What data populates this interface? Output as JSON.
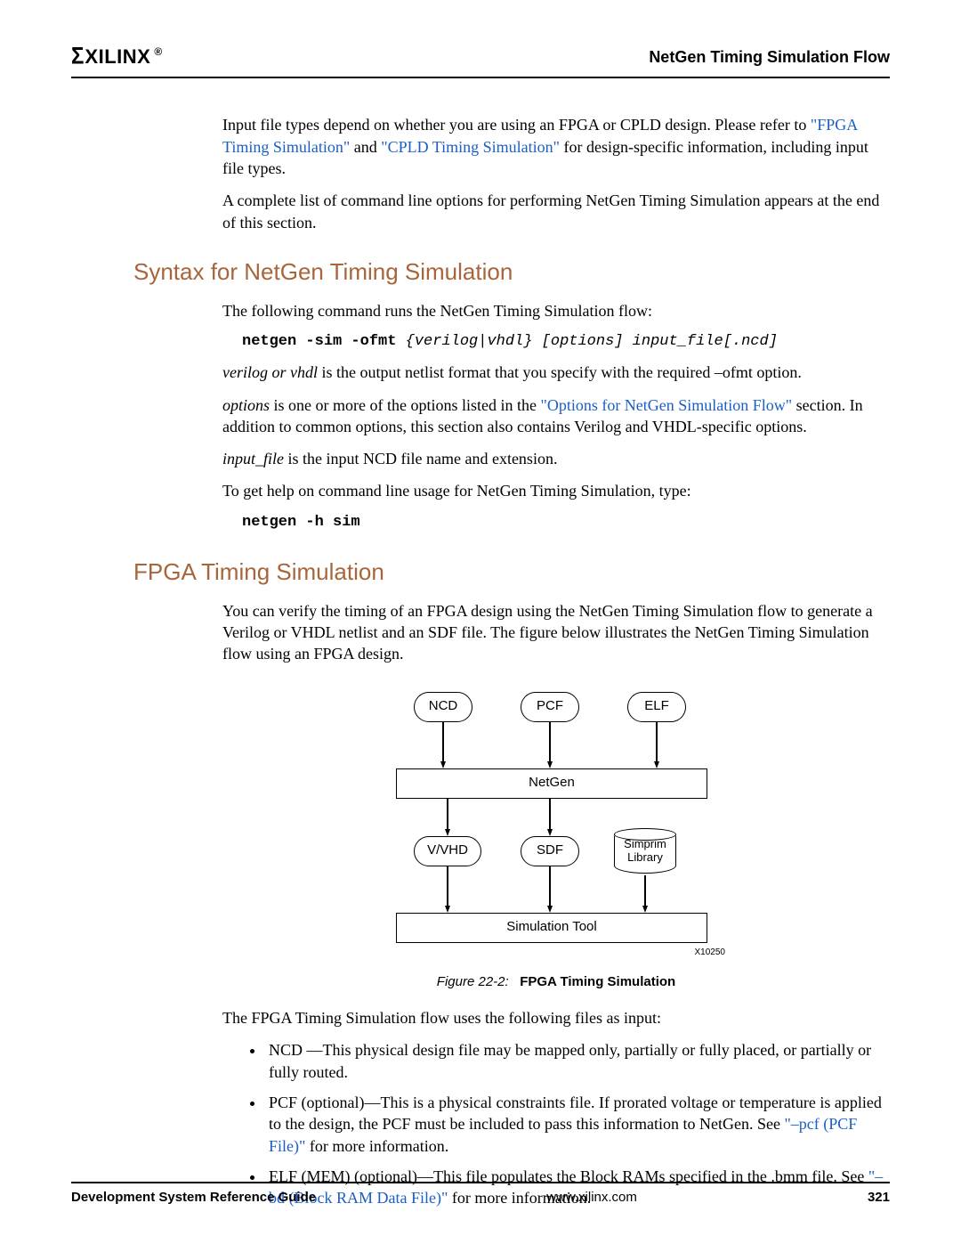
{
  "logo": {
    "sigmas": "Σ",
    "name": "XILINX",
    "reg": "®"
  },
  "header_title": "NetGen Timing Simulation Flow",
  "intro": {
    "p1a": "Input file types depend on whether you are using an FPGA or CPLD design. Please refer to ",
    "link1": "\"FPGA Timing Simulation\"",
    "p1mid": " and ",
    "link2": "\"CPLD Timing Simulation\"",
    "p1b": " for design-specific information, including input file types.",
    "p2": "A complete list of command line options for performing NetGen Timing Simulation appears at the end of this section."
  },
  "h1": "Syntax for NetGen Timing Simulation",
  "syntax": {
    "p1": "The following command runs the NetGen Timing Simulation flow:",
    "code_bold": "netgen -sim -ofmt ",
    "code_ital": "{verilog|vhdl} [options] input_file[.ncd]",
    "p2a": "verilog or vhdl",
    "p2b": " is the output netlist format that you specify with the required –ofmt option.",
    "p3a": "options",
    "p3b": " is one or more of the options listed in the ",
    "link3": "\"Options for NetGen Simulation Flow\"",
    "p3c": " section. In addition to common options, this section also contains Verilog and VHDL-specific options.",
    "p4a": "input_file",
    "p4b": " is the input NCD file name and extension.",
    "p5": "To get help on command line usage for NetGen Timing Simulation, type:",
    "code2": "netgen -h sim"
  },
  "h2": "FPGA Timing Simulation",
  "fpga": {
    "p1": "You can verify the timing of an FPGA design using the NetGen Timing Simulation flow to generate a Verilog or VHDL netlist and an SDF file. The figure below illustrates the NetGen Timing Simulation flow using an FPGA design.",
    "fig_label": "Figure 22-2:",
    "fig_title": "FPGA Timing Simulation",
    "fig_id": "X10250",
    "p2": "The FPGA Timing Simulation flow uses the following files as input:",
    "bullets": [
      {
        "a": "NCD —This physical design file may be mapped only, partially or fully placed, or partially or fully routed."
      },
      {
        "a": "PCF (optional)—This is a physical constraints file. If prorated voltage or temperature is applied to the design, the PCF must be included to pass this information to NetGen. See ",
        "link": "\"–pcf (PCF File)\"",
        "b": " for more information."
      },
      {
        "a": "ELF (MEM) (optional)—This file populates the Block RAMs specified in the .bmm file. See ",
        "link": "\"–bd (Block RAM Data File)\"",
        "b": " for more information."
      }
    ]
  },
  "diagram": {
    "ncd": "NCD",
    "pcf": "PCF",
    "elf": "ELF",
    "netgen": "NetGen",
    "vvhd": "V/VHD",
    "sdf": "SDF",
    "simlib": "Simprim\nLibrary",
    "simtool": "Simulation Tool"
  },
  "footer": {
    "left": "Development System Reference Guide",
    "mid": "www.xilinx.com",
    "right": "321"
  }
}
